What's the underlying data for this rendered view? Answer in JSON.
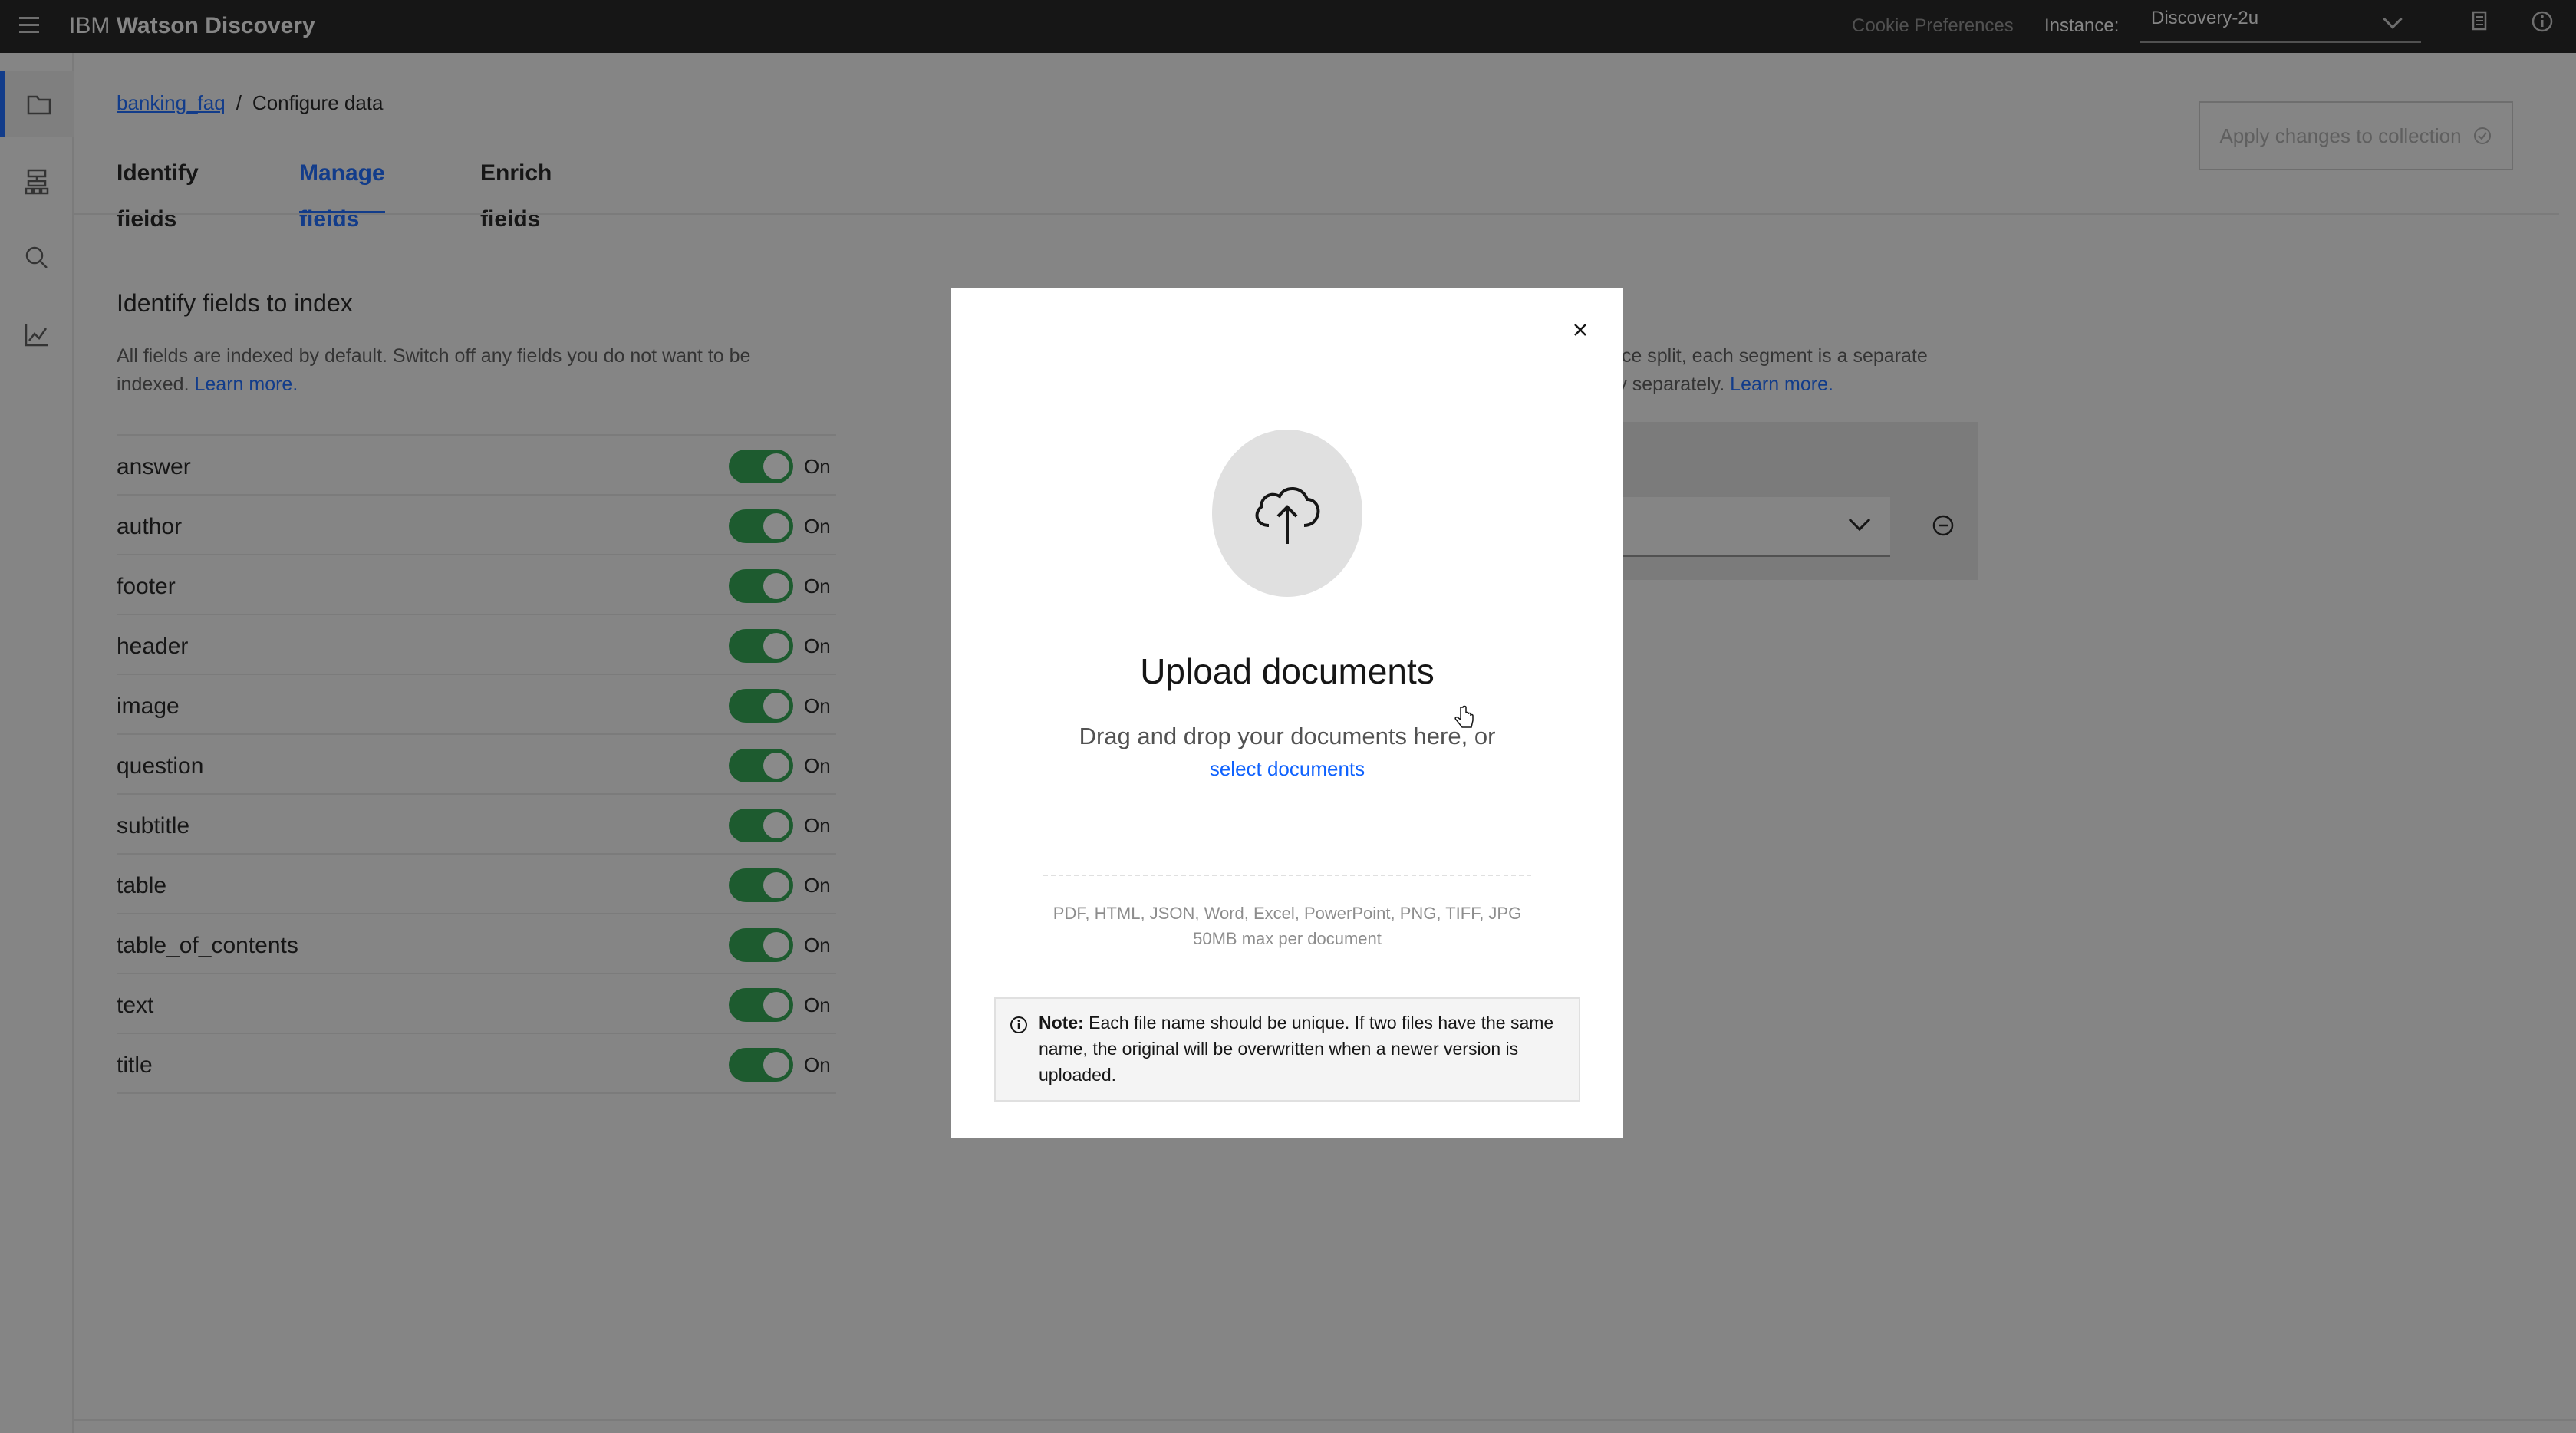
{
  "header": {
    "brand_prefix": "IBM",
    "brand_name": "Watson Discovery",
    "cookie_preferences": "Cookie Preferences",
    "instance_label": "Instance:",
    "instance_value": "Discovery-2u"
  },
  "rail": {
    "items": [
      "folder-icon",
      "structure-icon",
      "search-icon",
      "chart-icon"
    ],
    "active": "folder-icon"
  },
  "breadcrumb": {
    "collection": "banking_faq",
    "separator": "/",
    "current": "Configure data"
  },
  "apply_button": {
    "label": "Apply changes to collection"
  },
  "tabs": [
    {
      "label": "Identify fields"
    },
    {
      "label": "Manage fields"
    },
    {
      "label": "Enrich fields"
    }
  ],
  "active_tab": "Manage fields",
  "index_section": {
    "title": "Identify fields to index",
    "description": "All fields are indexed by default. Switch off any fields you do not want to be indexed.",
    "learn_more": "Learn more.",
    "fields": [
      {
        "name": "answer",
        "state": "On"
      },
      {
        "name": "author",
        "state": "On"
      },
      {
        "name": "footer",
        "state": "On"
      },
      {
        "name": "header",
        "state": "On"
      },
      {
        "name": "image",
        "state": "On"
      },
      {
        "name": "question",
        "state": "On"
      },
      {
        "name": "subtitle",
        "state": "On"
      },
      {
        "name": "table",
        "state": "On"
      },
      {
        "name": "table_of_contents",
        "state": "On"
      },
      {
        "name": "text",
        "state": "On"
      },
      {
        "name": "title",
        "state": "On"
      }
    ]
  },
  "split_section": {
    "description_line1": "nce split, each segment is a separate",
    "description_line2": "ry separately.",
    "learn_more": "Learn more."
  },
  "modal": {
    "title": "Upload documents",
    "drag_text": "Drag and drop your documents here, or",
    "select_link": "select documents",
    "formats": "PDF, HTML, JSON, Word, Excel, PowerPoint, PNG, TIFF, JPG",
    "max_size": "50MB max per document",
    "note_label": "Note:",
    "note_text": "Each file name should be unique. If two files have the same name, the original will be overwritten when a newer version is uploaded."
  },
  "colors": {
    "topbar": "#161616",
    "accent": "#0f62fe",
    "toggle_on": "#24a148",
    "overlay": "rgba(22,22,22,0.5)"
  }
}
